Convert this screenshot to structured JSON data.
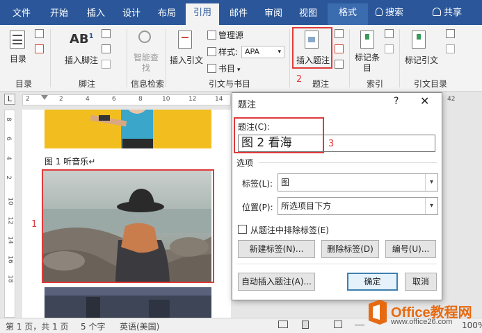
{
  "tabs": [
    "文件",
    "开始",
    "插入",
    "设计",
    "布局",
    "引用",
    "邮件",
    "审阅",
    "视图",
    "格式"
  ],
  "search": "搜索",
  "share": "共享",
  "ribbon": {
    "toc": "目录",
    "toc_group": "目录",
    "footnote": "插入脚注",
    "ab_icon": "AB",
    "ab_sup": "1",
    "footnote_group": "脚注",
    "smart_lookup": "智能查找",
    "research_group": "信息检索",
    "insert_citation": "插入引文",
    "manage_sources": "管理源",
    "style_label": "样式:",
    "style_value": "APA",
    "bibliography": "书目",
    "citations_group": "引文与书目",
    "insert_caption": "插入题注",
    "captions_group": "题注",
    "mark_entry": "标记条目",
    "index_group": "索引",
    "mark_citation": "标记引文",
    "authorities_group": "引文目录"
  },
  "annotations": {
    "a1": "1",
    "a2": "2",
    "a3": "3"
  },
  "ruler": {
    "h": [
      "2",
      "2",
      "4",
      "6",
      "8",
      "10",
      "12",
      "14"
    ],
    "h_right": "42",
    "v": [
      "8",
      "6",
      "4",
      "2",
      "10",
      "12",
      "14",
      "16",
      "18"
    ]
  },
  "document": {
    "caption1": "图 1 听音乐↵"
  },
  "dialog": {
    "title": "题注",
    "help": "?",
    "close": "✕",
    "caption_label": "题注(C):",
    "caption_value": "图 2 看海",
    "options": "选项",
    "label_label": "标签(L):",
    "label_value": "图",
    "position_label": "位置(P):",
    "position_value": "所选项目下方",
    "exclude_label": "从题注中排除标签(E)",
    "new_label": "新建标签(N)...",
    "delete_label": "删除标签(D)",
    "numbering": "编号(U)...",
    "autocaption": "自动插入题注(A)...",
    "ok": "确定",
    "cancel": "取消"
  },
  "status": {
    "page": "第 1 页，共 1 页",
    "words": "5 个字",
    "lang": "英语(美国)",
    "zoom": "100%"
  },
  "watermark": {
    "title": "Office教程网",
    "url": "www.office26.com"
  },
  "colors": {
    "tabbar": "#2b579a",
    "annot": "#e03a3a",
    "brand": "#e66a11"
  }
}
